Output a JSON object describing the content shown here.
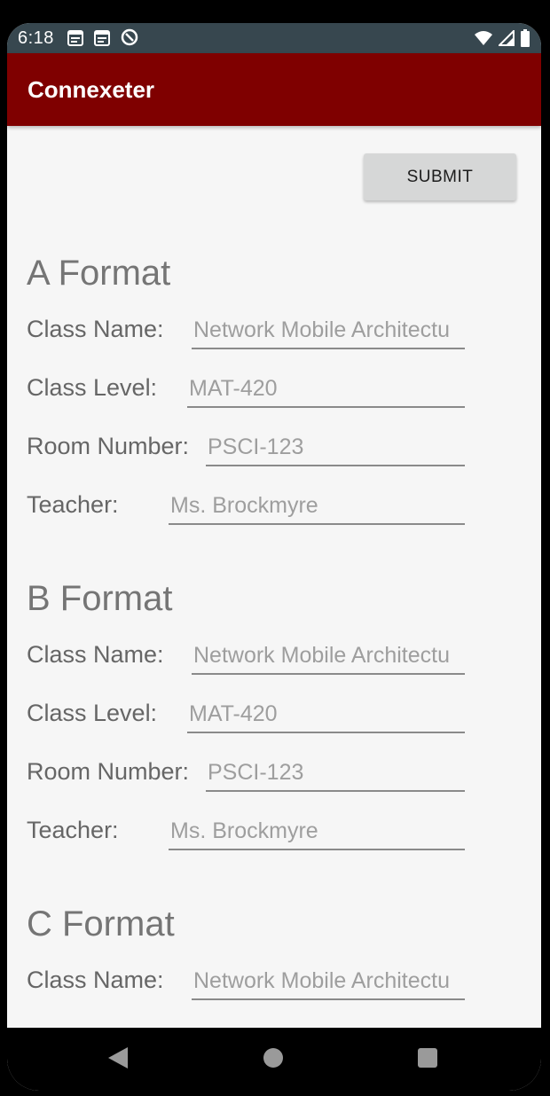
{
  "status": {
    "time": "6:18",
    "icons_left": [
      "calendar-icon",
      "calendar-icon",
      "sync-icon"
    ],
    "icons_right": [
      "wifi-icon",
      "signal-icon",
      "battery-icon"
    ]
  },
  "app": {
    "title": "Connexeter",
    "bar_color": "#7f0000"
  },
  "submit_label": "SUBMIT",
  "sections": [
    {
      "title": "A Format",
      "fields": [
        {
          "label": "Class Name:",
          "placeholder": "Network Mobile Architectu"
        },
        {
          "label": "Class Level:",
          "placeholder": "MAT-420"
        },
        {
          "label": "Room Number:",
          "placeholder": "PSCI-123"
        },
        {
          "label": "Teacher:",
          "placeholder": "Ms. Brockmyre"
        }
      ]
    },
    {
      "title": "B Format",
      "fields": [
        {
          "label": "Class Name:",
          "placeholder": "Network Mobile Architectu"
        },
        {
          "label": "Class Level:",
          "placeholder": "MAT-420"
        },
        {
          "label": "Room Number:",
          "placeholder": "PSCI-123"
        },
        {
          "label": "Teacher:",
          "placeholder": "Ms. Brockmyre"
        }
      ]
    },
    {
      "title": "C Format",
      "fields": [
        {
          "label": "Class Name:",
          "placeholder": "Network Mobile Architectu"
        }
      ]
    }
  ],
  "navbar": {
    "buttons": [
      "back-icon",
      "home-icon",
      "recents-icon"
    ]
  }
}
